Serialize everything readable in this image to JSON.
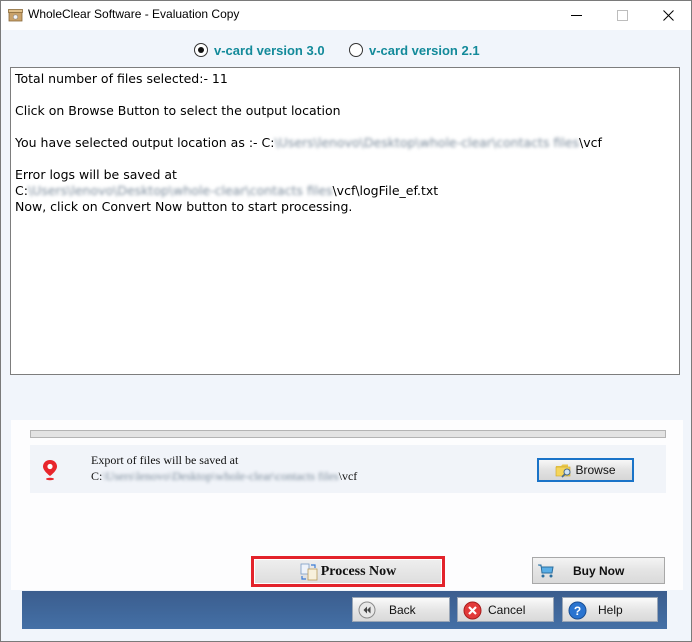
{
  "window": {
    "title": "WholeClear Software - Evaluation Copy",
    "controls": {
      "minimize": "minimize",
      "maximize": "maximize",
      "close": "close"
    }
  },
  "version_options": [
    {
      "label": "v-card version 3.0",
      "selected": true
    },
    {
      "label": "v-card version 2.1",
      "selected": false
    }
  ],
  "log": {
    "total_files": "Total number of files selected:- 11",
    "browse_hint": "Click on Browse Button to select the output location",
    "selected_prefix": "You have selected output location as :- C:",
    "selected_blurred": "\\Users\\lenovo\\Desktop\\whole-clear\\contacts files",
    "selected_suffix": "\\vcf",
    "error_logs": "Error logs will be saved at",
    "error_path_prefix": "C:",
    "error_path_blurred": "\\Users\\lenovo\\Desktop\\whole-clear\\contacts files",
    "error_path_suffix": "\\vcf\\logFile_ef.txt",
    "convert_hint": "Now, click on Convert Now button to start processing."
  },
  "export": {
    "label": "Export of files will be saved at",
    "path_prefix": "C:",
    "path_blurred": "\\Users\\lenovo\\Desktop\\whole-clear\\contacts files",
    "path_suffix": "\\vcf",
    "progress_percent": 0
  },
  "buttons": {
    "browse": "Browse",
    "process_now": "Process Now",
    "buy_now": "Buy Now",
    "back": "Back",
    "cancel": "Cancel",
    "help": "Help"
  },
  "colors": {
    "radio_label": "#138a9a",
    "highlight_border": "#e3232b",
    "nav_bar": "#3b5d8e",
    "browse_focus": "#1a73c8"
  }
}
